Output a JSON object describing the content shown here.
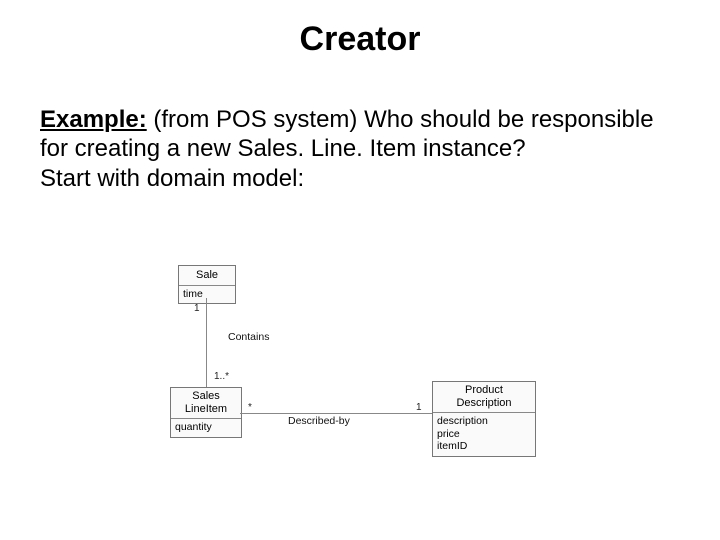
{
  "slide": {
    "title": "Creator",
    "example_lead": "Example:",
    "example_rest": " (from POS system) Who should be responsible for creating a new Sales. Line. Item instance?",
    "line2": "Start with domain model:"
  },
  "diagram": {
    "sale": {
      "name": "Sale",
      "attr1": "time"
    },
    "sli": {
      "name_line1": "Sales",
      "name_line2": "LineItem",
      "attr1": "quantity"
    },
    "pd": {
      "name_line1": "Product",
      "name_line2": "Description",
      "attr1": "description",
      "attr2": "price",
      "attr3": "itemID"
    },
    "assoc_contains": "Contains",
    "assoc_described": "Described-by",
    "mult_sale_end": "1",
    "mult_sli_top": "1..*",
    "mult_sli_right": "*",
    "mult_pd_left": "1"
  }
}
